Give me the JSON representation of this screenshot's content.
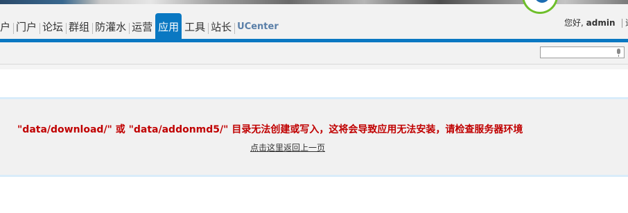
{
  "header": {
    "nav_items": [
      {
        "label": "户"
      },
      {
        "label": "门户"
      },
      {
        "label": "论坛"
      },
      {
        "label": "群组"
      },
      {
        "label": "防灌水"
      },
      {
        "label": "运营"
      },
      {
        "label": "应用",
        "active": true
      },
      {
        "label": "工具"
      },
      {
        "label": "站长"
      },
      {
        "label": "UCenter"
      }
    ],
    "user": {
      "greeting": "您好,",
      "username": "admin",
      "overflow_text": "退"
    }
  },
  "search": {
    "placeholder": "",
    "icon": "microphone-icon"
  },
  "message": {
    "error_text": "\"data/download/\" 或 \"data/addonmd5/\" 目录无法创建或写入，这将会导致应用无法安装，请检查服务器环境",
    "back_link": "点击这里返回上一页"
  },
  "colors": {
    "accent": "#0a78c2",
    "error": "#c00000",
    "panel_bg": "#f1f1f1",
    "panel_border": "#d9ecfa"
  }
}
